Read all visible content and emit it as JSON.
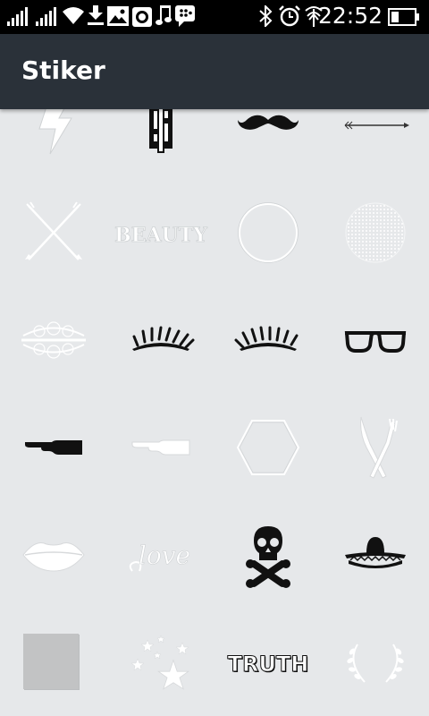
{
  "status_bar": {
    "time": "22:52",
    "icons": [
      "signal-icon",
      "signal-icon",
      "wifi-icon",
      "download-icon",
      "image-icon",
      "camera-icon",
      "music-icon",
      "bbm-icon",
      "bluetooth-icon",
      "alarm-icon",
      "network-icon",
      "battery-icon"
    ]
  },
  "app_bar": {
    "title": "Stiker"
  },
  "stickers": {
    "beauty_text": "BEAUTY",
    "love_text": "love",
    "truth_text": "TRUTH",
    "items": [
      "lightning",
      "dollar",
      "mustache",
      "arrow",
      "crossed-arrows",
      "beauty",
      "circle",
      "dotted-circle",
      "doily-frame",
      "eyelashes",
      "eyelashes",
      "glasses",
      "hand-pointer-black",
      "hand-pointer-white",
      "hexagon",
      "knife-fork",
      "lips",
      "love",
      "skull-crossbones",
      "sombrero",
      "gray-square",
      "stars",
      "truth",
      "laurel"
    ]
  }
}
